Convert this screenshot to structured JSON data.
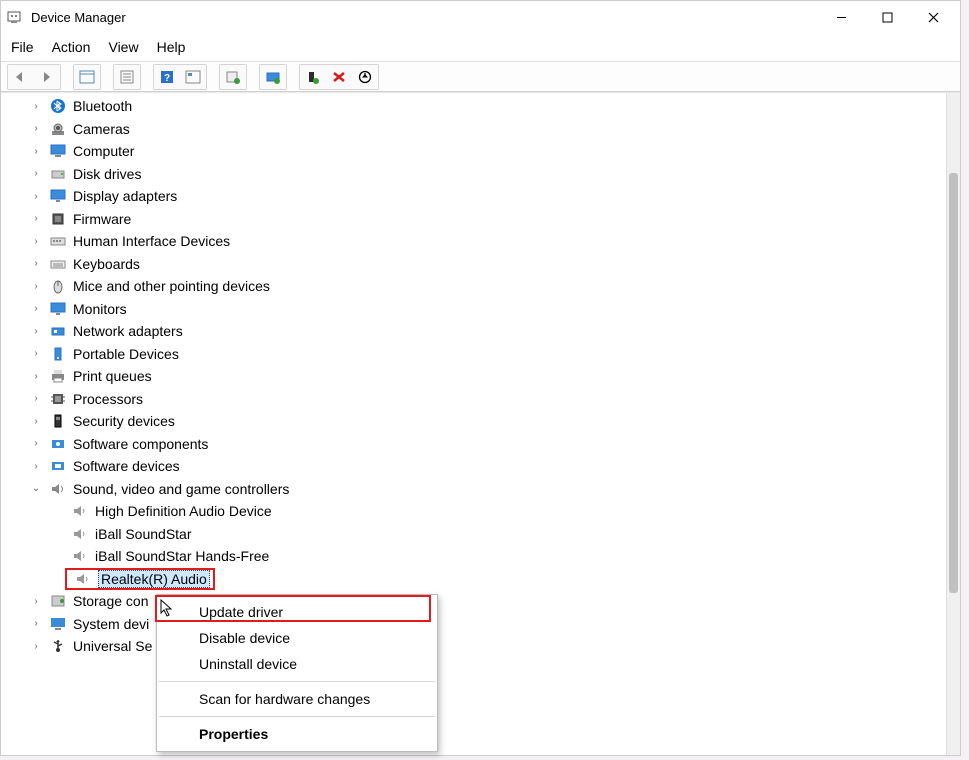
{
  "window": {
    "title": "Device Manager"
  },
  "menu": {
    "file": "File",
    "action": "Action",
    "view": "View",
    "help": "Help"
  },
  "tree": {
    "categories": [
      {
        "label": "Bluetooth",
        "icon": "bluetooth"
      },
      {
        "label": "Cameras",
        "icon": "camera"
      },
      {
        "label": "Computer",
        "icon": "computer"
      },
      {
        "label": "Disk drives",
        "icon": "disk"
      },
      {
        "label": "Display adapters",
        "icon": "display"
      },
      {
        "label": "Firmware",
        "icon": "firmware"
      },
      {
        "label": "Human Interface Devices",
        "icon": "hid"
      },
      {
        "label": "Keyboards",
        "icon": "keyboard"
      },
      {
        "label": "Mice and other pointing devices",
        "icon": "mouse"
      },
      {
        "label": "Monitors",
        "icon": "monitor"
      },
      {
        "label": "Network adapters",
        "icon": "network"
      },
      {
        "label": "Portable Devices",
        "icon": "portable"
      },
      {
        "label": "Print queues",
        "icon": "print"
      },
      {
        "label": "Processors",
        "icon": "cpu"
      },
      {
        "label": "Security devices",
        "icon": "security"
      },
      {
        "label": "Software components",
        "icon": "softcomp"
      },
      {
        "label": "Software devices",
        "icon": "softdev"
      },
      {
        "label": "Sound, video and game controllers",
        "icon": "sound",
        "expanded": true
      }
    ],
    "sound_children": [
      {
        "label": "High Definition Audio Device"
      },
      {
        "label": "iBall SoundStar"
      },
      {
        "label": "iBall SoundStar Hands-Free"
      },
      {
        "label": "Realtek(R) Audio",
        "selected": true
      }
    ],
    "after": [
      {
        "label": "Storage con",
        "icon": "storage"
      },
      {
        "label": "System devi",
        "icon": "system"
      },
      {
        "label": "Universal Se",
        "icon": "usb"
      }
    ]
  },
  "contextmenu": {
    "items": [
      {
        "label": "Update driver"
      },
      {
        "label": "Disable device"
      },
      {
        "label": "Uninstall device"
      },
      {
        "sep": true
      },
      {
        "label": "Scan for hardware changes"
      },
      {
        "sep": true
      },
      {
        "label": "Properties",
        "bold": true
      }
    ]
  }
}
